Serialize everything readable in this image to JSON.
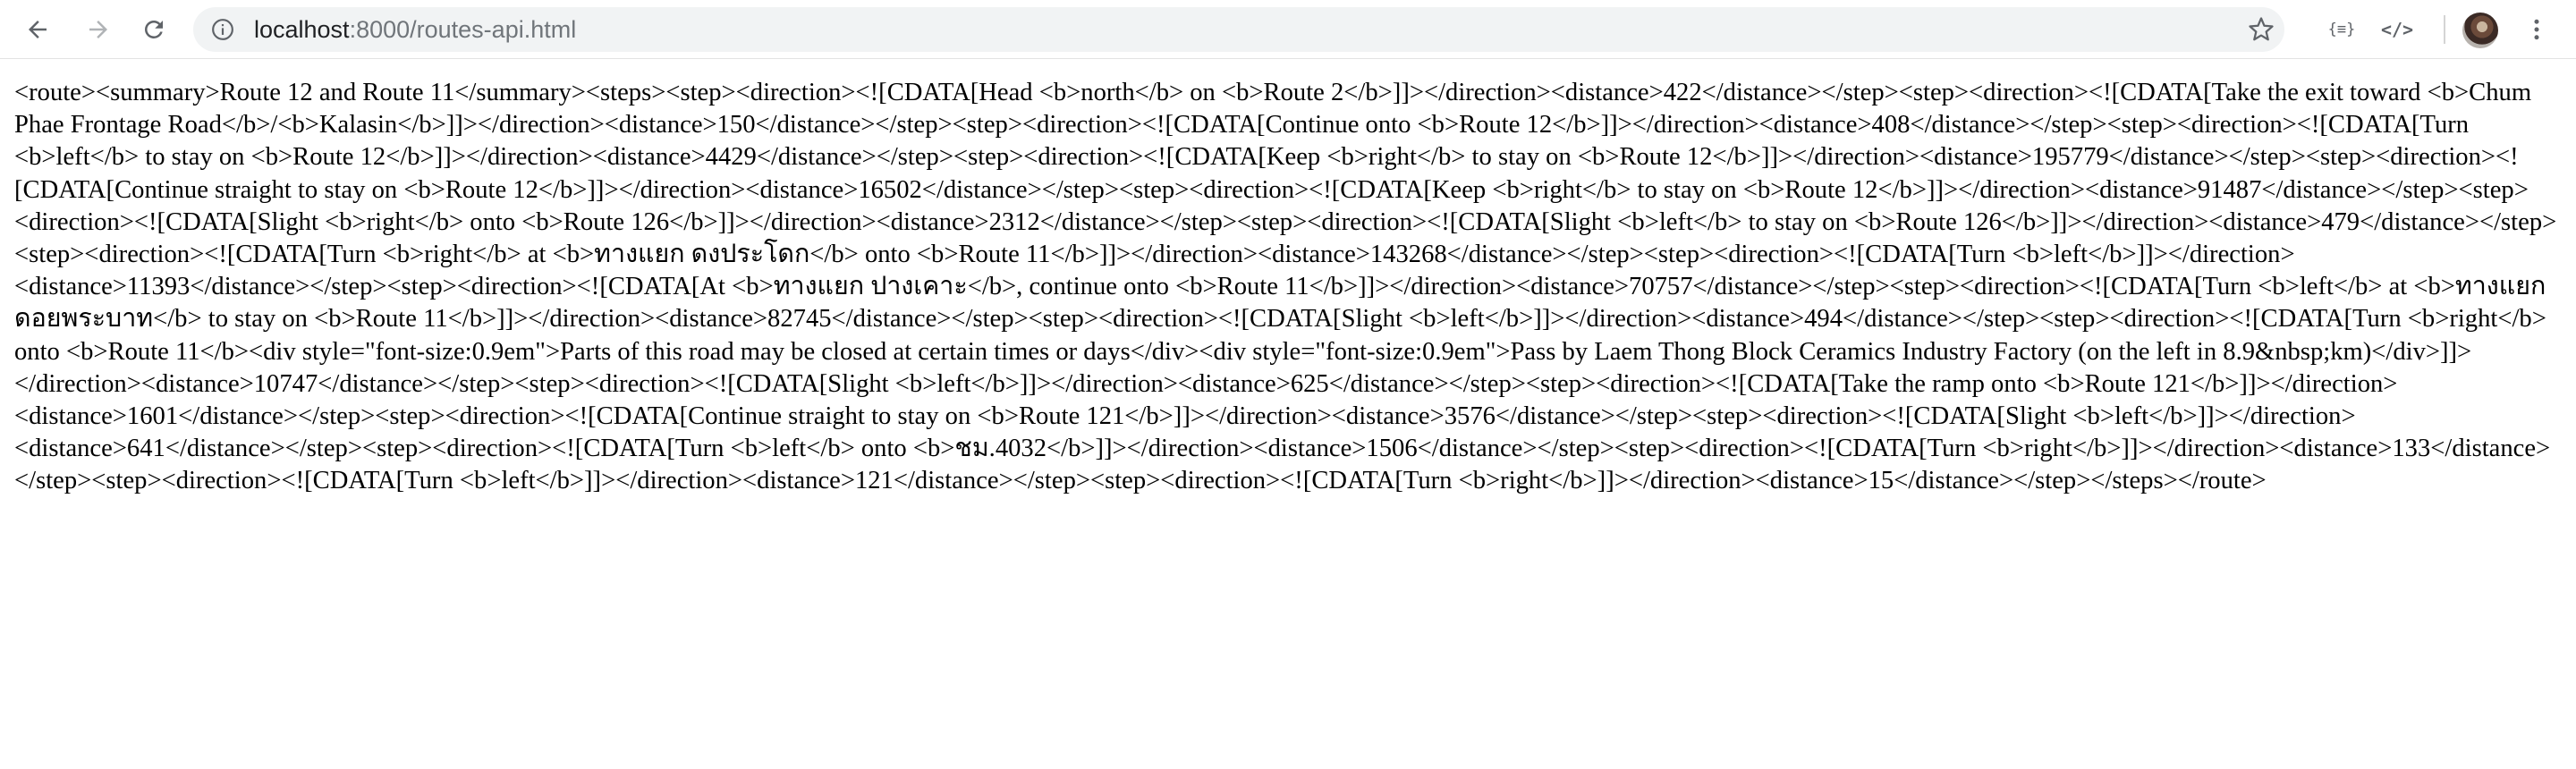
{
  "browser": {
    "url_host": "localhost",
    "url_path": ":8000/routes-api.html",
    "icons": {
      "back": "arrow-left-icon",
      "forward": "arrow-right-icon",
      "reload": "reload-icon",
      "site_info": "info-icon",
      "bookmark": "star-icon",
      "ext_json": "json-viewer-icon",
      "ext_code": "code-icon",
      "menu": "three-dot-menu-icon"
    },
    "ext_json_label": "{≡}",
    "ext_code_label": "</>"
  },
  "page": {
    "xml_text": "<route><summary>Route 12 and Route 11</summary><steps><step><direction><![CDATA[Head <b>north</b> on <b>Route 2</b>]]></direction><distance>422</distance></step><step><direction><![CDATA[Take the exit toward <b>Chum Phae Frontage Road</b>/<b>Kalasin</b>]]></direction><distance>150</distance></step><step><direction><![CDATA[Continue onto <b>Route 12</b>]]></direction><distance>408</distance></step><step><direction><![CDATA[Turn <b>left</b> to stay on <b>Route 12</b>]]></direction><distance>4429</distance></step><step><direction><![CDATA[Keep <b>right</b> to stay on <b>Route 12</b>]]></direction><distance>195779</distance></step><step><direction><![CDATA[Continue straight to stay on <b>Route 12</b>]]></direction><distance>16502</distance></step><step><direction><![CDATA[Keep <b>right</b> to stay on <b>Route 12</b>]]></direction><distance>91487</distance></step><step><direction><![CDATA[Slight <b>right</b> onto <b>Route 126</b>]]></direction><distance>2312</distance></step><step><direction><![CDATA[Slight <b>left</b> to stay on <b>Route 126</b>]]></direction><distance>479</distance></step><step><direction><![CDATA[Turn <b>right</b> at <b>ทางแยก ดงประโดก</b> onto <b>Route 11</b>]]></direction><distance>143268</distance></step><step><direction><![CDATA[Turn <b>left</b>]]></direction><distance>11393</distance></step><step><direction><![CDATA[At <b>ทางแยก ปางเคาะ</b>, continue onto <b>Route 11</b>]]></direction><distance>70757</distance></step><step><direction><![CDATA[Turn <b>left</b> at <b>ทางแยก ดอยพระบาท</b> to stay on <b>Route 11</b>]]></direction><distance>82745</distance></step><step><direction><![CDATA[Slight <b>left</b>]]></direction><distance>494</distance></step><step><direction><![CDATA[Turn <b>right</b> onto <b>Route 11</b><div style=\"font-size:0.9em\">Parts of this road may be closed at certain times or days</div><div style=\"font-size:0.9em\">Pass by Laem Thong Block Ceramics Industry Factory (on the left in 8.9&nbsp;km)</div>]]></direction><distance>10747</distance></step><step><direction><![CDATA[Slight <b>left</b>]]></direction><distance>625</distance></step><step><direction><![CDATA[Take the ramp onto <b>Route 121</b>]]></direction><distance>1601</distance></step><step><direction><![CDATA[Continue straight to stay on <b>Route 121</b>]]></direction><distance>3576</distance></step><step><direction><![CDATA[Slight <b>left</b>]]></direction><distance>641</distance></step><step><direction><![CDATA[Turn <b>left</b> onto <b>ชม.4032</b>]]></direction><distance>1506</distance></step><step><direction><![CDATA[Turn <b>right</b>]]></direction><distance>133</distance></step><step><direction><![CDATA[Turn <b>left</b>]]></direction><distance>121</distance></step><step><direction><![CDATA[Turn <b>right</b>]]></direction><distance>15</distance></step></steps></route>"
  }
}
